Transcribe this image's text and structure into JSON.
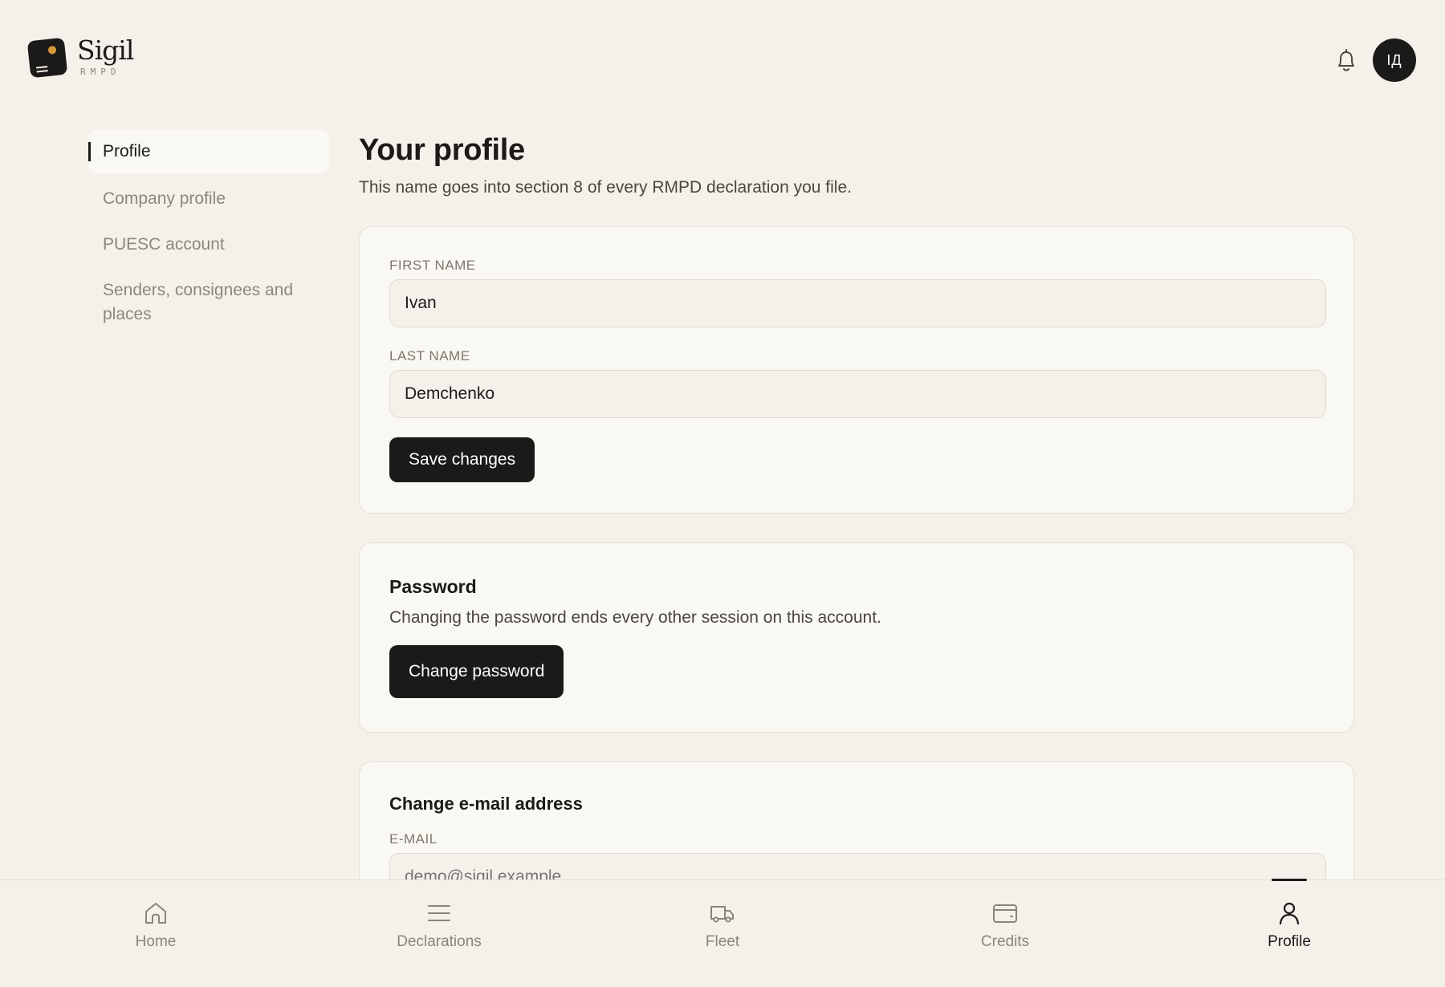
{
  "brand": {
    "name": "Sigil",
    "subtitle": "RMPD"
  },
  "header": {
    "notifications_icon": "bell-icon",
    "avatar_initials": "IД"
  },
  "sidebar": {
    "items": [
      {
        "label": "Profile",
        "active": true
      },
      {
        "label": "Company profile",
        "active": false
      },
      {
        "label": "PUESC account",
        "active": false
      },
      {
        "label": "Senders, consignees and places",
        "active": false
      }
    ]
  },
  "main": {
    "title": "Your profile",
    "subtitle": "This name goes into section 8 of every RMPD declaration you file.",
    "name_card": {
      "first_name_label": "FIRST NAME",
      "first_name_value": "Ivan",
      "last_name_label": "LAST NAME",
      "last_name_value": "Demchenko",
      "save_label": "Save changes"
    },
    "password_card": {
      "title": "Password",
      "description": "Changing the password ends every other session on this account.",
      "button_label": "Change password"
    },
    "email_card": {
      "title": "Change e-mail address",
      "email_label": "E-MAIL",
      "email_placeholder": "demo@sigil.example"
    }
  },
  "bottom_nav": {
    "items": [
      {
        "label": "Home",
        "icon": "home-icon",
        "active": false
      },
      {
        "label": "Declarations",
        "icon": "menu-icon",
        "active": false
      },
      {
        "label": "Fleet",
        "icon": "truck-icon",
        "active": false
      },
      {
        "label": "Credits",
        "icon": "card-icon",
        "active": false
      },
      {
        "label": "Profile",
        "icon": "user-icon",
        "active": true
      }
    ]
  },
  "colors": {
    "background": "#F4F1EA",
    "card": "#FAF8F2",
    "accent_dark": "#1C1A18",
    "logo_dot": "#D49A3A",
    "muted_text": "#8C877E"
  }
}
